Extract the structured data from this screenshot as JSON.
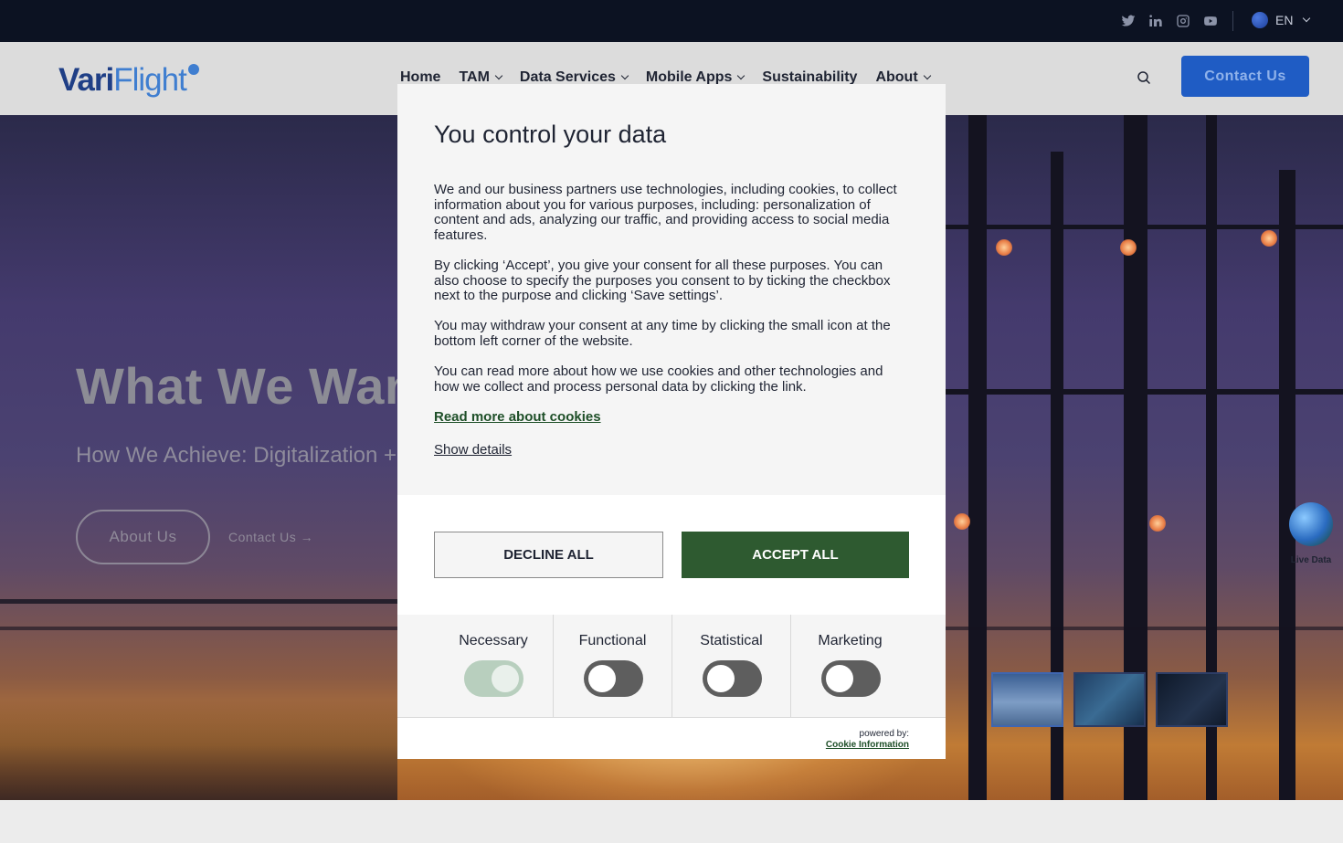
{
  "topbar": {
    "social_icons": [
      "twitter-icon",
      "linkedin-icon",
      "instagram-icon",
      "youtube-icon"
    ],
    "language": "EN"
  },
  "nav": {
    "logo_vari": "Vari",
    "logo_flight": "Flight",
    "items": [
      {
        "label": "Home",
        "has_dropdown": false
      },
      {
        "label": "TAM",
        "has_dropdown": true
      },
      {
        "label": "Data Services",
        "has_dropdown": true
      },
      {
        "label": "Mobile Apps",
        "has_dropdown": true
      },
      {
        "label": "Sustainability",
        "has_dropdown": false
      },
      {
        "label": "About",
        "has_dropdown": true
      }
    ],
    "contact_label": "Contact Us"
  },
  "hero": {
    "title": "What We Wan",
    "subtitle": "How We Achieve: Digitalization +",
    "about_button": "About Us",
    "contact_link": "Contact Us →",
    "live_data_label": "Live Data"
  },
  "consent": {
    "title": "You control your data",
    "paragraphs": [
      "We and our business partners use technologies, including cookies, to collect information about you for various purposes, including: personalization of content and ads, analyzing our traffic, and providing access to social media features.",
      "By clicking ‘Accept’, you give your consent for all these purposes. You can also choose to specify the purposes you consent to by ticking the checkbox next to the purpose and clicking ‘Save settings’.",
      "You may withdraw your consent at any time by clicking the small icon at the bottom left corner of the website.",
      "You can read more about how we use cookies and other technologies and how we collect and process personal data by clicking the link."
    ],
    "read_more": "Read more about cookies",
    "show_details": "Show details",
    "decline_label": "DECLINE ALL",
    "accept_label": "ACCEPT ALL",
    "categories": [
      {
        "label": "Necessary",
        "enabled": true
      },
      {
        "label": "Functional",
        "enabled": false
      },
      {
        "label": "Statistical",
        "enabled": false
      },
      {
        "label": "Marketing",
        "enabled": false
      }
    ],
    "powered_by": "powered by:",
    "provider": "Cookie Information"
  },
  "colors": {
    "accept_green": "#2e5a30",
    "brand_blue": "#1f5cc4",
    "topbar_navy": "#0c1222"
  }
}
